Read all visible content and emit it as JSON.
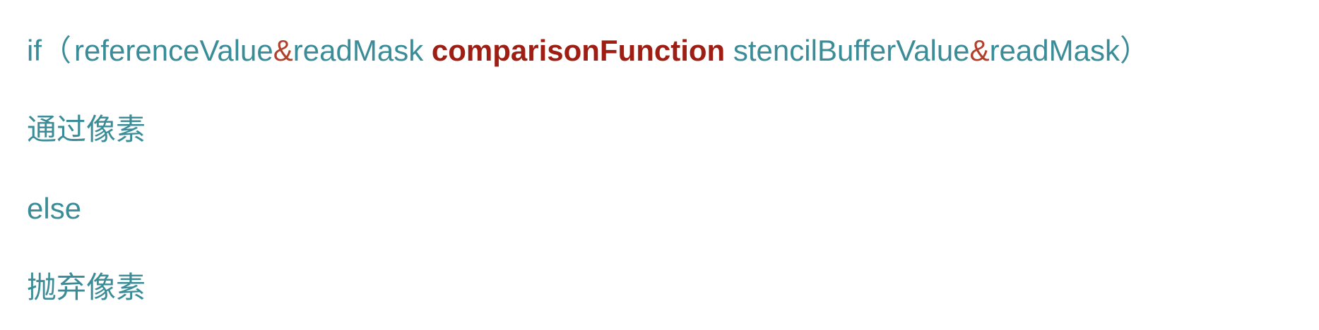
{
  "lines": {
    "condition": {
      "keyword": "if",
      "paren_open": "（",
      "ref_value": "referenceValue",
      "amp1": "&",
      "read_mask1": "readMask",
      "function": "comparisonFunction",
      "stencil_value": "stencilBufferValue",
      "amp2": "&",
      "read_mask2": "readMask",
      "paren_close": "）"
    },
    "pass": "通过像素",
    "else": "else",
    "discard": "抛弃像素"
  },
  "colors": {
    "text": "#3a8d98",
    "operator": "#b0402c",
    "function": "#9e1e14"
  }
}
